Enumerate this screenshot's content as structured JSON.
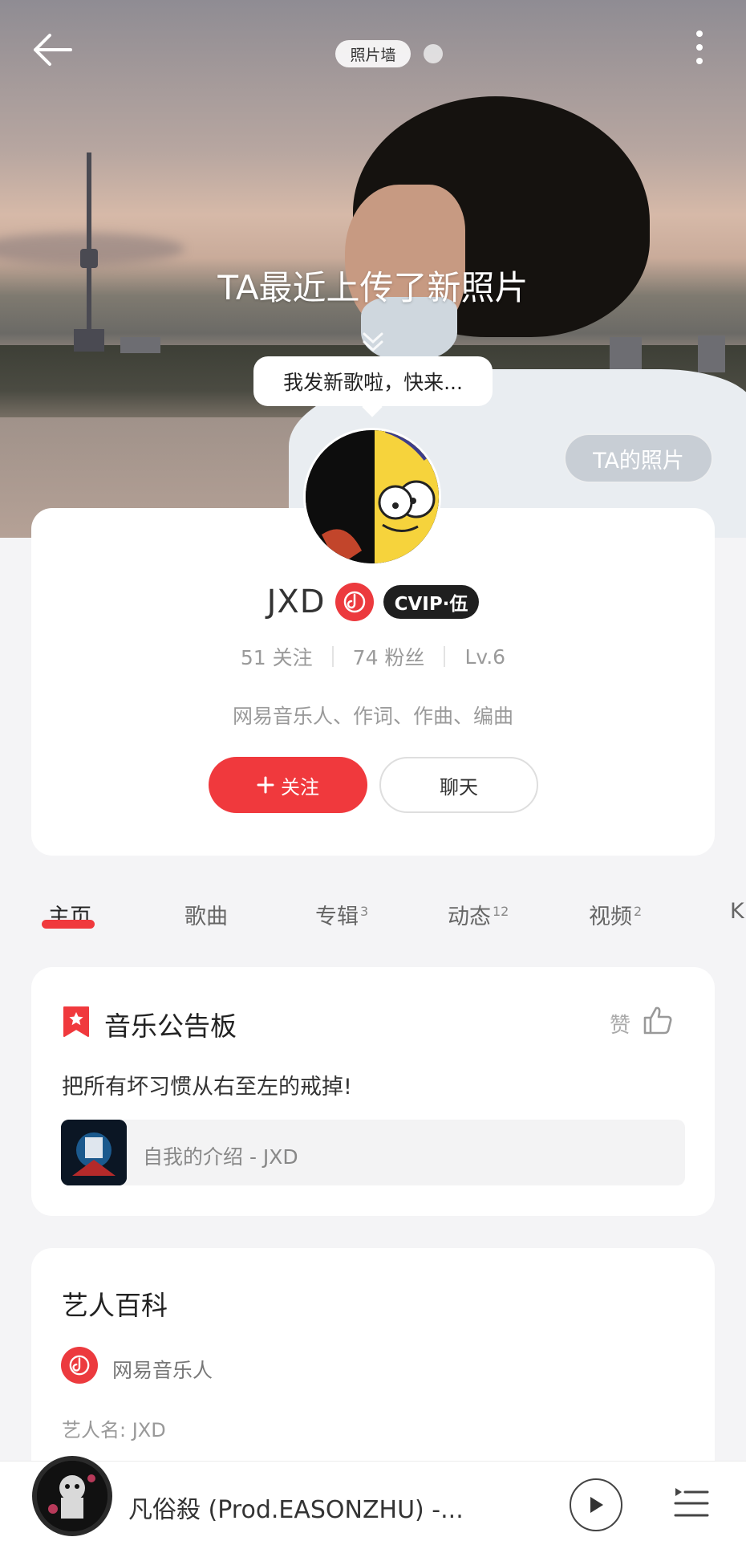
{
  "header": {
    "photo_wall_label": "照片墙",
    "hero_caption": "TA最近上传了新照片",
    "speech_bubble": "我发新歌啦，快来...",
    "ta_photos_button": "TA的照片"
  },
  "profile": {
    "name": "JXD",
    "vip_badge": "CVIP·伍",
    "following": "51 关注",
    "followers": "74 粉丝",
    "level": "Lv.6",
    "bio": "网易音乐人、作词、作曲、编曲",
    "follow_button": "关注",
    "chat_button": "聊天"
  },
  "tabs": [
    {
      "label": "主页",
      "count": ""
    },
    {
      "label": "歌曲",
      "count": ""
    },
    {
      "label": "专辑",
      "count": "3"
    },
    {
      "label": "动态",
      "count": "12"
    },
    {
      "label": "视频",
      "count": "2"
    },
    {
      "label": "K",
      "count": ""
    }
  ],
  "board": {
    "title": "音乐公告板",
    "like_label": "赞",
    "text": "把所有坏习惯从右至左的戒掉!",
    "song_link": "自我的介绍 - JXD"
  },
  "wiki": {
    "title": "艺人百科",
    "badge_label": "网易音乐人",
    "artist_name": "艺人名: JXD"
  },
  "player": {
    "title": "凡俗殺 (Prod.EASONZHU) -..."
  },
  "colors": {
    "accent": "#f0393d",
    "badge_red": "#ec3a3e",
    "background": "#f4f4f6"
  },
  "icons": {
    "back": "back-arrow-icon",
    "more": "more-vertical-icon",
    "chevron": "chevron-down-icon",
    "musician": "musician-badge-icon",
    "plus": "plus-icon",
    "bookmark": "bookmark-star-icon",
    "like": "thumbs-up-icon",
    "play": "play-icon",
    "playlist": "playlist-icon"
  }
}
